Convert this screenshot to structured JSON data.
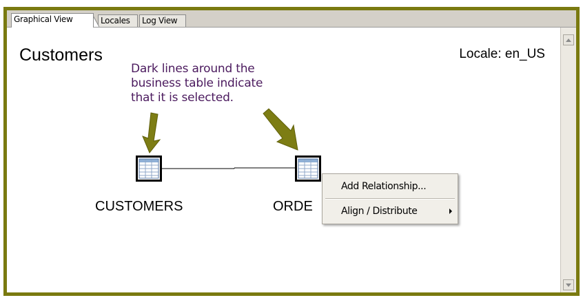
{
  "tabs": [
    {
      "label": "Graphical View",
      "active": true
    },
    {
      "label": "Locales",
      "active": false
    },
    {
      "label": "Log View",
      "active": false
    }
  ],
  "canvas": {
    "title": "Customers",
    "locale": "Locale: en_US"
  },
  "callout": {
    "lines": [
      "Dark lines around the",
      "business table indicate",
      "that it is selected."
    ],
    "color": "#4b1a5e",
    "arrow_color": "#7d7d14"
  },
  "nodes": [
    {
      "label": "CUSTOMERS",
      "icon": "table-icon"
    },
    {
      "label": "ORDE",
      "icon": "table-icon"
    }
  ],
  "context_menu": {
    "items": [
      {
        "label": "Add Relationship...",
        "submenu": false
      },
      {
        "label": "Align / Distribute",
        "submenu": true
      }
    ]
  },
  "colors": {
    "frame": "#7a7a10",
    "tab_bar": "#d4d0c8"
  }
}
